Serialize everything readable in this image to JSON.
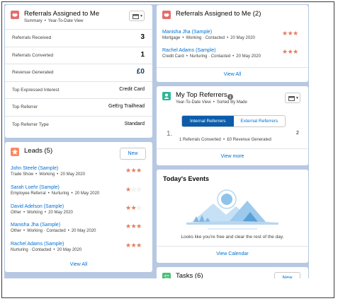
{
  "referrals_summary": {
    "title": "Referrals Assigned to Me",
    "subtitle_left": "Summary",
    "subtitle_right": "Year-To-Date View",
    "rows": [
      {
        "label": "Referrals Received",
        "value": "3"
      },
      {
        "label": "Referrals Converted",
        "value": "1"
      },
      {
        "label": "Revenue Generated",
        "value": "£0"
      },
      {
        "label": "Top Expressed Interest",
        "value": "Credit Card"
      },
      {
        "label": "Top Referrer",
        "value": "GeErg Trailhead"
      },
      {
        "label": "Top Referrer Type",
        "value": "Standard"
      }
    ]
  },
  "referrals_list": {
    "title": "Referrals Assigned to Me (2)",
    "items": [
      {
        "name": "Manisha Jha (Sample)",
        "meta": [
          "Mortgage",
          "Working · Contacted",
          "20 May 2020"
        ],
        "rating": 3
      },
      {
        "name": "Rachel Adams (Sample)",
        "meta": [
          "Credit Card",
          "Nurturing · Contacted",
          "20 May 2020"
        ],
        "rating": 3
      }
    ],
    "view_all": "View All"
  },
  "top_referrers": {
    "title": "My Top Referrers",
    "subtitle_left": "Year-To-Date View",
    "subtitle_right": "Sorted By Made",
    "tabs": [
      "Internal Referrers",
      "External Referrers"
    ],
    "active_tab": 0,
    "rank": "1.",
    "count": "2",
    "summary": "1 Referrals Converted  •  £0 Revenue Generated",
    "view_more": "View more"
  },
  "leads": {
    "title": "Leads (5)",
    "new_label": "New",
    "items": [
      {
        "name": "John Steele (Sample)",
        "meta": [
          "Trade Show",
          "Working",
          "20 May 2020"
        ],
        "rating": 3
      },
      {
        "name": "Sarah Loehr (Sample)",
        "meta": [
          "Employee Referral",
          "Nurturing",
          "20 May 2020"
        ],
        "rating": 1
      },
      {
        "name": "David Adelson (Sample)",
        "meta": [
          "Other",
          "Working",
          "20 May 2020"
        ],
        "rating": 2
      },
      {
        "name": "Manisha Jha (Sample)",
        "meta": [
          "Other",
          "Working · Contacted",
          "20 May 2020"
        ],
        "rating": 3
      },
      {
        "name": "Rachel Adams (Sample)",
        "meta": [
          "Nurturing · Contacted",
          "20 May 2020"
        ],
        "rating": 3
      }
    ],
    "view_all": "View All"
  },
  "events": {
    "title": "Today's Events",
    "message": "Looks like you're free and clear the rest of the day.",
    "view_calendar": "View Calendar"
  },
  "tasks": {
    "title": "Tasks (6)",
    "new_label": "New"
  },
  "colors": {
    "background": "#b6c8e2",
    "referral_icon": "#e46d6d",
    "leads_icon": "#f88962",
    "referrers_icon": "#30b896",
    "tasks_icon": "#4bc076",
    "link": "#0070d2",
    "star_on": "#e37c5c",
    "tab_active": "#0b5cab"
  },
  "icons": {
    "referral": "handshake-icon",
    "leads": "star-badge-icon",
    "referrers": "person-badge-icon",
    "tasks": "checklist-icon",
    "dropdown": "calendar-icon",
    "info": "info-icon"
  }
}
